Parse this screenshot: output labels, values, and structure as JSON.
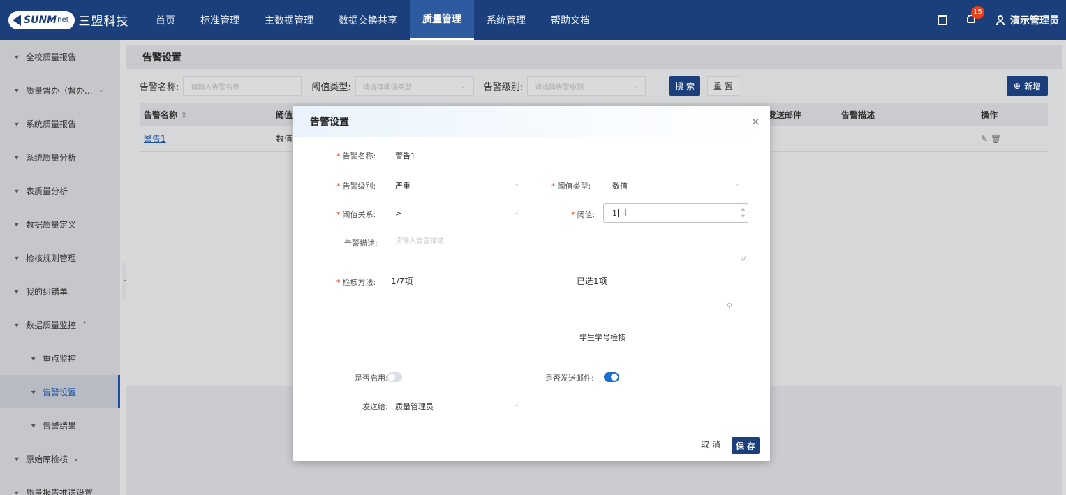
{
  "header": {
    "logo_text": "SUNM",
    "logo_net": "net",
    "logo_cn": "三盟科技",
    "nav": [
      {
        "label": "首页"
      },
      {
        "label": "标准管理"
      },
      {
        "label": "主数据管理"
      },
      {
        "label": "数据交换共享"
      },
      {
        "label": "质量管理"
      },
      {
        "label": "系统管理"
      },
      {
        "label": "帮助文档"
      }
    ],
    "notification_count": "15",
    "user_name": "演示管理员"
  },
  "sidebar": {
    "items": [
      {
        "label": "全校质量报告"
      },
      {
        "label": "质量督办（督办..."
      },
      {
        "label": "系统质量报告"
      },
      {
        "label": "系统质量分析"
      },
      {
        "label": "表质量分析"
      },
      {
        "label": "数据质量定义"
      },
      {
        "label": "检核规则管理"
      },
      {
        "label": "我的纠错单"
      },
      {
        "label": "数据质量监控"
      },
      {
        "label": "重点监控"
      },
      {
        "label": "告警设置"
      },
      {
        "label": "告警结果"
      },
      {
        "label": "原始库检核"
      },
      {
        "label": "质量报告推送设置"
      }
    ]
  },
  "main": {
    "title": "告警设置",
    "filters": {
      "name_label": "告警名称:",
      "name_placeholder": "请输入告警名称",
      "threshold_type_label": "阈值类型:",
      "threshold_type_placeholder": "请选择阈值类型",
      "level_label": "告警级别:",
      "level_placeholder": "请选择告警级别",
      "search_button": "搜 索",
      "reset_button": "重 置",
      "add_button": "新增"
    },
    "table": {
      "headers": {
        "name": "告警名称",
        "threshold": "阈值",
        "send_email": "发送邮件",
        "description": "告警描述",
        "actions": "操作"
      },
      "rows": [
        {
          "name": "警告1",
          "threshold": "数值"
        }
      ]
    }
  },
  "modal": {
    "title": "告警设置",
    "fields": {
      "name_label": "告警名称:",
      "name_value": "警告1",
      "level_label": "告警级别:",
      "level_value": "严重",
      "threshold_type_label": "阈值类型:",
      "threshold_type_value": "数值",
      "relation_label": "阈值关系:",
      "relation_value": ">",
      "threshold_label": "阈值:",
      "threshold_value": "1",
      "description_label": "告警描述:",
      "description_placeholder": "请输入告警描述",
      "method_label": "检核方法:",
      "method_left_count": "1/7项",
      "method_selected": "已选1项",
      "method_item": "学生学号检核",
      "enabled_label": "是否启用:",
      "send_email_label": "是否发送邮件:",
      "send_to_label": "发送给:",
      "send_to_value": "质量管理员"
    },
    "enabled": false,
    "send_email": true,
    "cancel_button": "取 消",
    "save_button": "保 存"
  }
}
